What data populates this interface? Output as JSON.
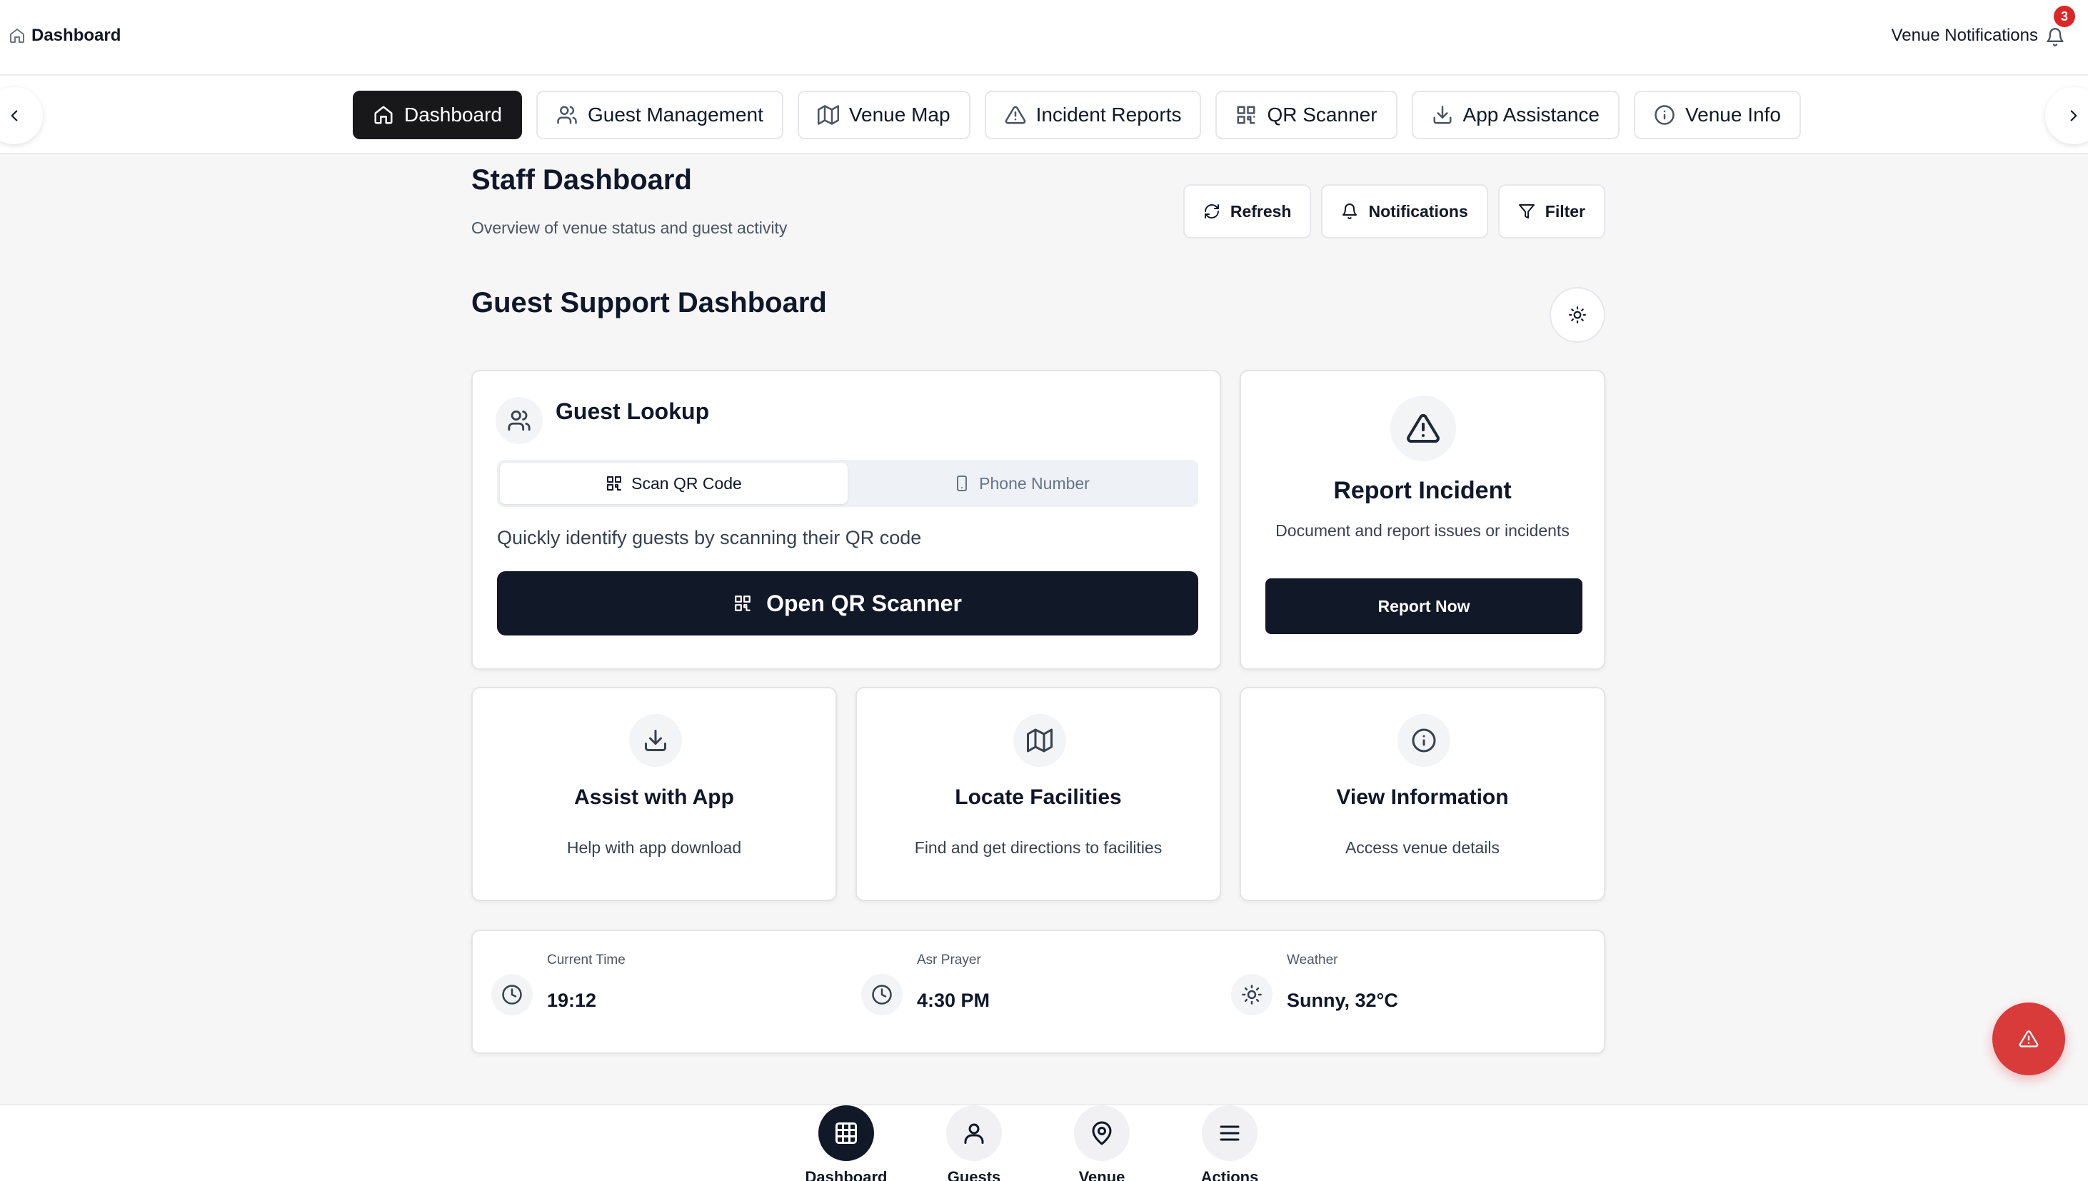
{
  "header": {
    "breadcrumb": "Dashboard",
    "notifications_label": "Venue Notifications",
    "notification_count": "3"
  },
  "nav": {
    "tabs": [
      {
        "label": "Dashboard",
        "icon": "home-icon",
        "active": true
      },
      {
        "label": "Guest Management",
        "icon": "users-icon"
      },
      {
        "label": "Venue Map",
        "icon": "map-icon"
      },
      {
        "label": "Incident Reports",
        "icon": "warning-icon"
      },
      {
        "label": "QR Scanner",
        "icon": "qr-icon"
      },
      {
        "label": "App Assistance",
        "icon": "download-icon"
      },
      {
        "label": "Venue Info",
        "icon": "info-icon"
      }
    ]
  },
  "page": {
    "title": "Staff Dashboard",
    "subtitle": "Overview of venue status and guest activity",
    "actions": {
      "refresh": "Refresh",
      "notifications": "Notifications",
      "filter": "Filter"
    },
    "section_title": "Guest Support Dashboard"
  },
  "lookup": {
    "title": "Guest Lookup",
    "tabs": {
      "scan": "Scan QR Code",
      "phone": "Phone Number"
    },
    "description": "Quickly identify guests by scanning their QR code",
    "button": "Open QR Scanner"
  },
  "report": {
    "title": "Report Incident",
    "description": "Document and report issues or incidents",
    "button": "Report Now"
  },
  "cards": {
    "assist": {
      "title": "Assist with App",
      "description": "Help with app download"
    },
    "locate": {
      "title": "Locate Facilities",
      "description": "Find and get directions to facilities"
    },
    "info": {
      "title": "View Information",
      "description": "Access venue details"
    }
  },
  "status": {
    "time": {
      "label": "Current Time",
      "value": "19:12"
    },
    "prayer": {
      "label": "Asr Prayer",
      "value": "4:30 PM"
    },
    "weather": {
      "label": "Weather",
      "value": "Sunny, 32°C"
    }
  },
  "bottom_nav": {
    "dashboard": "Dashboard",
    "guests": "Guests",
    "venue": "Venue",
    "actions": "Actions"
  },
  "colors": {
    "primary": "#111827",
    "accent_red": "#d93a3a",
    "badge_red": "#dc2626"
  }
}
